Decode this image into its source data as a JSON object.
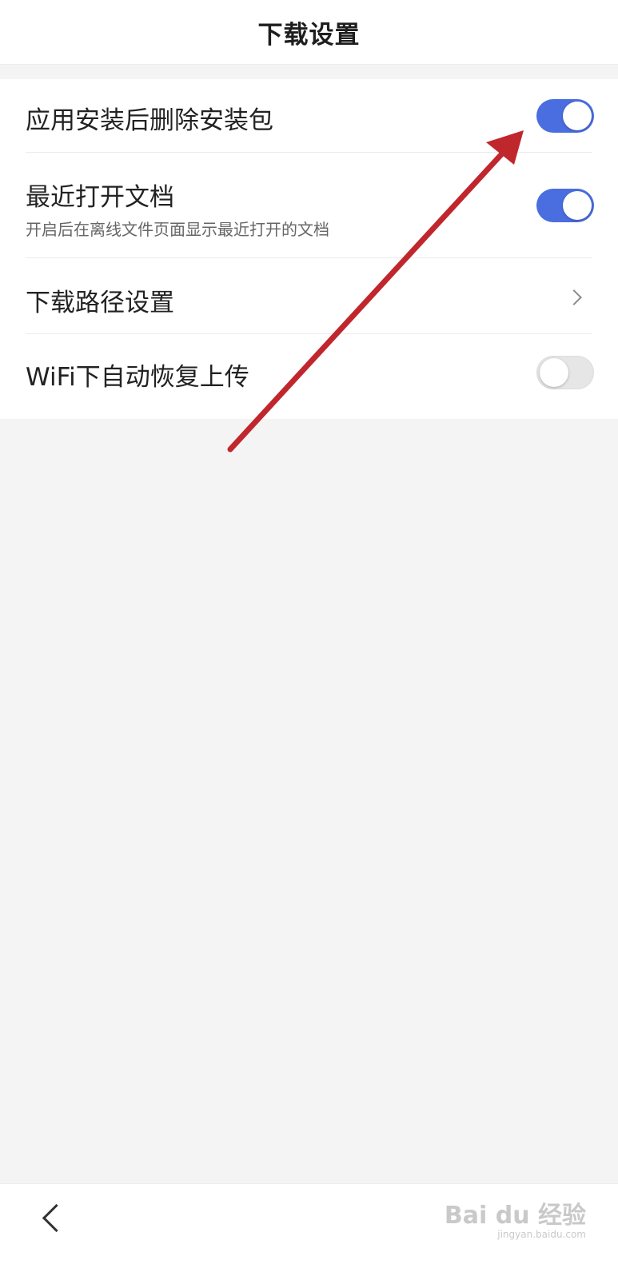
{
  "header": {
    "title": "下载设置"
  },
  "settings": [
    {
      "label": "应用安装后删除安装包",
      "toggle": "on"
    },
    {
      "label": "最近打开文档",
      "subtitle": "开启后在离线文件页面显示最近打开的文档",
      "toggle": "on"
    },
    {
      "label": "下载路径设置",
      "control": "chevron"
    },
    {
      "label": "WiFi下自动恢复上传",
      "toggle": "off"
    }
  ],
  "watermark": {
    "logo": "Bai du 经验",
    "sub": "jingyan.baidu.com"
  },
  "colors": {
    "toggle_on": "#4a6ee0",
    "arrow": "#c0272d",
    "background": "#f4f4f4"
  }
}
